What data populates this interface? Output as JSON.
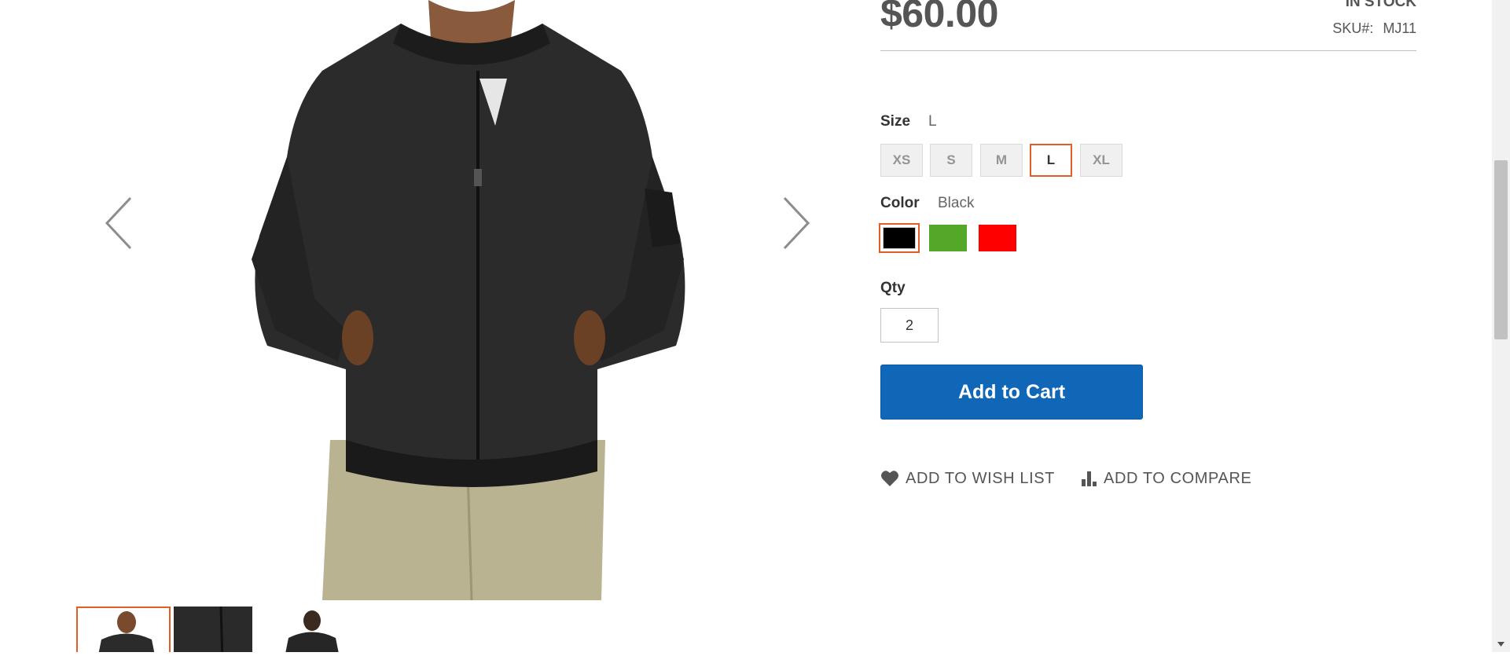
{
  "product": {
    "price": "$60.00",
    "stock": "IN STOCK",
    "sku_label": "SKU#:",
    "sku_value": "MJ11"
  },
  "size": {
    "label": "Size",
    "selected": "L",
    "options": [
      "XS",
      "S",
      "M",
      "L",
      "XL"
    ]
  },
  "color": {
    "label": "Color",
    "selected": "Black",
    "options": [
      {
        "name": "Black",
        "hex": "#000000"
      },
      {
        "name": "Green",
        "hex": "#53a828"
      },
      {
        "name": "Red",
        "hex": "#ff0000"
      }
    ]
  },
  "qty": {
    "label": "Qty",
    "value": "2"
  },
  "actions": {
    "add_to_cart": "Add to Cart",
    "wish_list": "ADD TO WISH LIST",
    "compare": "ADD TO COMPARE"
  },
  "colors": {
    "accent": "#e35d27",
    "primary_button": "#1067b7"
  },
  "icons": [
    "chevron-left-icon",
    "chevron-right-icon",
    "heart-icon",
    "bar-chart-icon",
    "scroll-down-arrow-icon"
  ]
}
